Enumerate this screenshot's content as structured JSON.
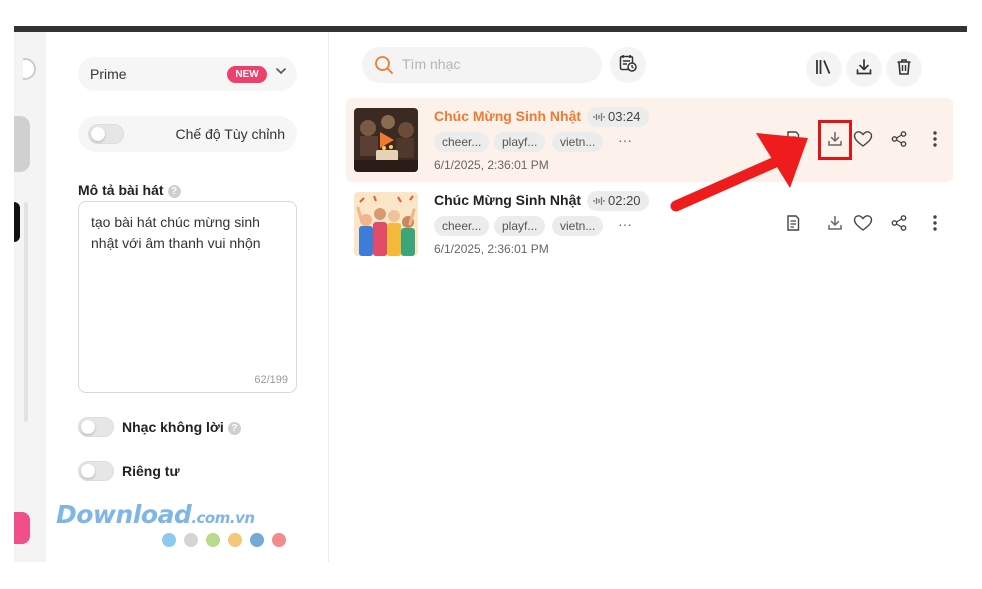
{
  "sidebar_panel": {
    "model": {
      "label": "Prime",
      "badge": "NEW"
    },
    "custom_mode": {
      "label": "Chế độ Tùy chỉnh"
    },
    "description": {
      "title": "Mô tả bài hát",
      "help": "?",
      "text": "tạo bài hát chúc mừng sinh nhật với âm thanh vui nhộn",
      "counter": "62/199"
    },
    "instrumental": {
      "label": "Nhạc không lời",
      "help": "?"
    },
    "private": {
      "label": "Riêng tư"
    }
  },
  "watermark": {
    "text": "Download",
    "domain": ".com.vn",
    "dot_colors": [
      "#8ec9f0",
      "#d5d5d5",
      "#b6db8c",
      "#f6c77b",
      "#74a9d9",
      "#f28b8b"
    ]
  },
  "main": {
    "search": {
      "placeholder": "Tìm nhạc",
      "value": ""
    },
    "songs": [
      {
        "title": "Chúc Mừng Sinh Nhật",
        "duration": "03:24",
        "tags": [
          "cheer...",
          "playf...",
          "vietn..."
        ],
        "more": "···",
        "date": "6/1/2025, 2:36:01 PM",
        "active": true
      },
      {
        "title": "Chúc Mừng Sinh Nhật",
        "duration": "02:20",
        "tags": [
          "cheer...",
          "playf...",
          "vietn..."
        ],
        "more": "···",
        "date": "6/1/2025, 2:36:01 PM",
        "active": false
      }
    ]
  },
  "colors": {
    "accent_orange": "#f07a2e",
    "new_badge": "#ef3f6b",
    "annotation_red": "#e31414",
    "active_row_bg": "#fdf1ec"
  }
}
